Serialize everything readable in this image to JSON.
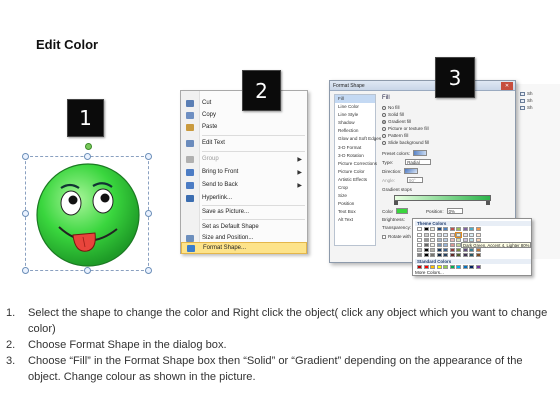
{
  "title": "Edit Color",
  "steps": {
    "one": "1",
    "two": "2",
    "three": "3"
  },
  "context_menu": {
    "items": [
      {
        "label": "Cut",
        "icon": "scissors-icon",
        "color": "#5b7fb5"
      },
      {
        "label": "Copy",
        "icon": "copy-icon",
        "color": "#6e8fc2"
      },
      {
        "label": "Paste",
        "icon": "paste-icon",
        "color": "#c99a3e"
      },
      {
        "label": "Edit Text",
        "icon": "edit-text-icon",
        "color": "#6b8cbd"
      },
      {
        "label": "Group",
        "icon": "group-icon",
        "color": "#b0b0b0",
        "disabled": true,
        "submenu": true
      },
      {
        "label": "Bring to Front",
        "icon": "bring-to-front-icon",
        "color": "#4c7cc4",
        "submenu": true
      },
      {
        "label": "Send to Back",
        "icon": "send-to-back-icon",
        "color": "#4c7cc4",
        "submenu": true
      },
      {
        "label": "Hyperlink...",
        "icon": "hyperlink-icon",
        "color": "#3b6db0"
      },
      {
        "label": "Save as Picture...",
        "icon": "",
        "color": ""
      },
      {
        "label": "Set as Default Shape",
        "icon": "",
        "color": ""
      },
      {
        "label": "Size and Position...",
        "icon": "size-position-icon",
        "color": "#6d8fbd"
      },
      {
        "label": "Format Shape...",
        "icon": "format-shape-icon",
        "color": "#3a7ccc",
        "highlighted": true
      }
    ]
  },
  "format_dialog": {
    "title": "Format Shape",
    "close_button": "Close",
    "nav": [
      "Fill",
      "Line Color",
      "Line Style",
      "Shadow",
      "Reflection",
      "Glow and Soft Edges",
      "3-D Format",
      "3-D Rotation",
      "Picture Corrections",
      "Picture Color",
      "Artistic Effects",
      "Crop",
      "Size",
      "Position",
      "Text Box",
      "Alt Text"
    ],
    "selected_nav": "Fill",
    "heading": "Fill",
    "fill_options": [
      {
        "label": "No fill",
        "selected": false
      },
      {
        "label": "Solid fill",
        "selected": false
      },
      {
        "label": "Gradient fill",
        "selected": true
      },
      {
        "label": "Picture or texture fill",
        "selected": false
      },
      {
        "label": "Pattern fill",
        "selected": false
      },
      {
        "label": "Slide background fill",
        "selected": false
      }
    ],
    "preset_label": "Preset colors:",
    "type_label": "Type:",
    "type_value": "Radial",
    "direction_label": "Direction:",
    "angle_label": "Angle:",
    "angle_value": "90°",
    "gradient_stops_label": "Gradient stops",
    "color_label": "Color",
    "position_label": "Position:",
    "position_value": "0%",
    "brightness_label": "Brightness:",
    "transparency_label": "Transparency:",
    "rotate_label": "Rotate with shape"
  },
  "palette": {
    "theme_header": "Theme Colors",
    "standard_header": "Standard Colors",
    "more_colors": "More Colors...",
    "tooltip": "Dark Green, Accent 4, Lighter 80%",
    "theme_row": [
      "#ffffff",
      "#000000",
      "#eeece1",
      "#1f497d",
      "#4f81bd",
      "#c0504d",
      "#9bbb59",
      "#8064a2",
      "#4bacc6",
      "#f79646"
    ],
    "standard_row": [
      "#c00000",
      "#ff0000",
      "#ffc000",
      "#ffff00",
      "#92d050",
      "#00b050",
      "#00b0f0",
      "#0070c0",
      "#002060",
      "#7030a0"
    ]
  },
  "side_panel": [
    "Sh",
    "Sh",
    "Sh"
  ],
  "face_color": "#35d03c",
  "instructions": [
    {
      "num": "1.",
      "text": "Select the shape to change the color and Right click the object( click any object which you want to change color)"
    },
    {
      "num": "2.",
      "text": "Choose Format Shape in the dialog box."
    },
    {
      "num": "3.",
      "text": "Choose “Fill” in the Format Shape box then “Solid” or “Gradient” depending on the appearance of the object. Change colour as shown in the picture."
    }
  ]
}
